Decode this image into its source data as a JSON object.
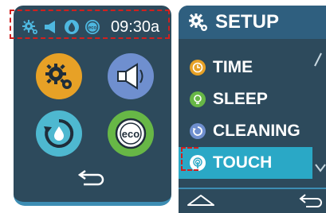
{
  "left_screen": {
    "status": {
      "icons": [
        "gear-icon",
        "speaker-icon",
        "water-drop-icon",
        "eco-icon"
      ],
      "time": "09:30a"
    },
    "tiles": [
      {
        "name": "settings",
        "icon": "gear-icon",
        "color": "#e7a126"
      },
      {
        "name": "sound",
        "icon": "speaker-icon",
        "color": "#6f8fcf"
      },
      {
        "name": "cleaning",
        "icon": "water-cycle-icon",
        "color": "#4eb8d0"
      },
      {
        "name": "eco",
        "icon": "eco-icon",
        "color": "#67b746"
      }
    ],
    "back_icon": "back-arrow-icon"
  },
  "right_screen": {
    "title": "SETUP",
    "title_icon": "gear-icon",
    "menu": [
      {
        "label": "TIME",
        "icon": "clock-icon",
        "color": "#e7a126",
        "selected": false
      },
      {
        "label": "SLEEP",
        "icon": "sleep-icon",
        "color": "#67b746",
        "selected": false
      },
      {
        "label": "CLEANING",
        "icon": "cleaning-icon",
        "color": "#6f8fcf",
        "selected": false
      },
      {
        "label": "TOUCH",
        "icon": "touch-icon",
        "color": "#2aa8c6",
        "selected": true
      }
    ],
    "bottom": {
      "home_icon": "home-icon",
      "back_icon": "back-arrow-icon"
    }
  },
  "colors": {
    "screen_bg": "#2d4a5c",
    "selected_bg": "#2aa8c6",
    "highlight_border": "#d0201e"
  }
}
